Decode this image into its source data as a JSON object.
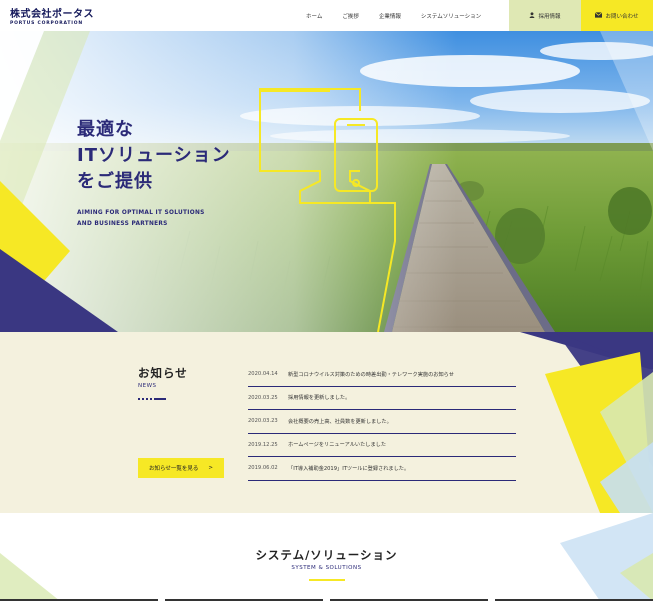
{
  "header": {
    "logo_jp": "株式会社ポータス",
    "logo_en": "PORTUS CORPORATION",
    "nav": [
      "ホーム",
      "ご挨拶",
      "企業情報",
      "システムソリューション"
    ],
    "recruit_label": "採用情報",
    "contact_label": "お問い合わせ"
  },
  "hero": {
    "title_lines": [
      "最適な",
      "ITソリューション",
      "をご提供"
    ],
    "sub_lines": [
      "AIMING FOR OPTIMAL IT SOLUTIONS",
      "AND BUSINESS PARTNERS"
    ]
  },
  "news": {
    "title": "お知らせ",
    "title_en": "NEWS",
    "button_label": "お知らせ一覧を見る",
    "button_arrow": ">",
    "items": [
      {
        "date": "2020.04.14",
        "text": "新型コロナウイルス対策のための時差出勤・テレワーク実施のお知らせ"
      },
      {
        "date": "2020.03.25",
        "text": "採用情報を更新しました。"
      },
      {
        "date": "2020.03.23",
        "text": "会社概要の売上高、社員数を更新しました。"
      },
      {
        "date": "2019.12.25",
        "text": "ホームページをリニューアルいたしました"
      },
      {
        "date": "2019.06.02",
        "text": "「IT導入補助金2019」ITツールに登録されました。"
      }
    ]
  },
  "systems": {
    "title": "システム/ソリューション",
    "title_en": "SYSTEM & SOLUTIONS"
  },
  "colors": {
    "navy": "#2b2a78",
    "yellow": "#f6e825",
    "lime": "#dfe8b4",
    "cream": "#f4f1de"
  },
  "icons": {
    "recruit": "person-icon",
    "contact": "mail-icon"
  }
}
